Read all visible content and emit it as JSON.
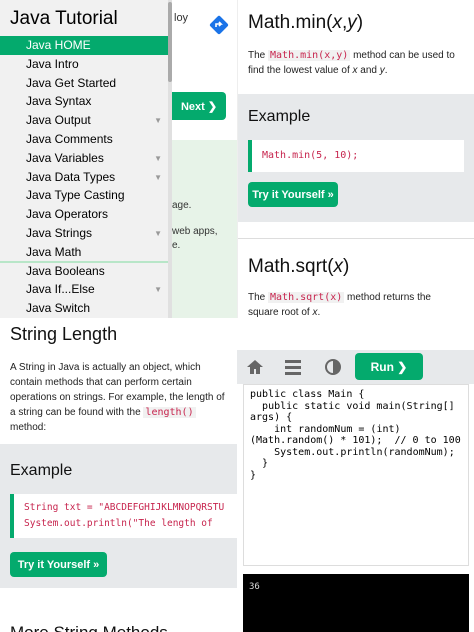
{
  "top_left": {
    "snippet_tag": "loy",
    "next_button": "Next ❯",
    "bg_text_1": "age.",
    "bg_text_2": "web apps,",
    "bg_text_3": "e.",
    "sidebar": {
      "title": "Java Tutorial",
      "items": [
        {
          "label": "Java HOME",
          "active": true,
          "arrow": false
        },
        {
          "label": "Java Intro",
          "active": false,
          "arrow": false
        },
        {
          "label": "Java Get Started",
          "active": false,
          "arrow": false
        },
        {
          "label": "Java Syntax",
          "active": false,
          "arrow": false
        },
        {
          "label": "Java Output",
          "active": false,
          "arrow": true
        },
        {
          "label": "Java Comments",
          "active": false,
          "arrow": false
        },
        {
          "label": "Java Variables",
          "active": false,
          "arrow": true
        },
        {
          "label": "Java Data Types",
          "active": false,
          "arrow": true
        },
        {
          "label": "Java Type Casting",
          "active": false,
          "arrow": false
        },
        {
          "label": "Java Operators",
          "active": false,
          "arrow": false
        },
        {
          "label": "Java Strings",
          "active": false,
          "arrow": true
        },
        {
          "label": "Java Math",
          "active": false,
          "arrow": false
        },
        {
          "label": "Java Booleans",
          "active": false,
          "arrow": false
        },
        {
          "label": "Java If...Else",
          "active": false,
          "arrow": true
        },
        {
          "label": "Java Switch",
          "active": false,
          "arrow": false
        }
      ]
    }
  },
  "top_right": {
    "min_title_pre": "Math.min(",
    "min_title_x": "x",
    "min_title_comma": ",",
    "min_title_y": "y",
    "min_title_post": ")",
    "min_desc_1": "The ",
    "min_desc_code": "Math.min(x,y)",
    "min_desc_2": " method can be used to",
    "min_desc_3": "find the lowest value of ",
    "min_desc_x": "x",
    "min_desc_and": " and ",
    "min_desc_y": "y",
    "min_desc_end": ".",
    "example_heading": "Example",
    "example_code": "Math.min(5, 10);",
    "try_button": "Try it Yourself »",
    "sqrt_title_pre": "Math.sqrt(",
    "sqrt_title_x": "x",
    "sqrt_title_post": ")",
    "sqrt_desc_1": "The ",
    "sqrt_desc_code": "Math.sqrt(x)",
    "sqrt_desc_2": " method returns the",
    "sqrt_desc_3": "square root of ",
    "sqrt_desc_x": "x",
    "sqrt_desc_end": "."
  },
  "bottom_left": {
    "title": "String Length",
    "para_1": "A String in Java is actually an object, which",
    "para_2": "contain methods that can perform certain",
    "para_3": "operations on strings. For example, the length of",
    "para_4": "a string can be found with the ",
    "para_code": "length()",
    "para_5": "method:",
    "example_heading": "Example",
    "code_line_1": "String txt = \"ABCDEFGHIJKLMNOPQRSTU",
    "code_line_2": "System.out.println(\"The length of",
    "try_button": "Try it Yourself »",
    "next_heading": "More String Methods"
  },
  "bottom_right": {
    "run_button": "Run ❯",
    "code": "public class Main {\n  public static void main(String[]\nargs) {\n    int randomNum = (int)\n(Math.random() * 101);  // 0 to 100\n    System.out.println(randomNum);\n  }\n}",
    "output": "36"
  },
  "colors": {
    "accent_green": "#04AA6D",
    "sidebar_bg": "#f1f1f1",
    "code_red": "#c7254e",
    "example_bg": "#e7e9eb"
  }
}
